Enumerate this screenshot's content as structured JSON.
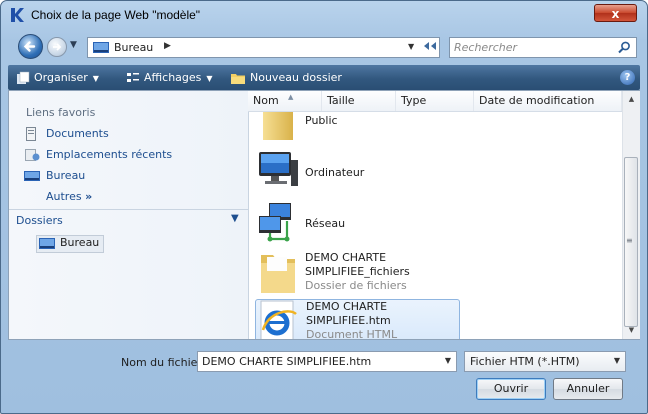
{
  "window": {
    "title": "Choix de la page Web \"modèle\"",
    "close_label": "x"
  },
  "address": {
    "location": "Bureau",
    "search_placeholder": "Rechercher"
  },
  "toolbar": {
    "organize": "Organiser",
    "views": "Affichages",
    "new_folder": "Nouveau dossier"
  },
  "sidebar": {
    "favorites_heading": "Liens favoris",
    "items": [
      {
        "label": "Documents",
        "icon": "documents-icon"
      },
      {
        "label": "Emplacements récents",
        "icon": "recent-places-icon"
      },
      {
        "label": "Bureau",
        "icon": "desktop-icon"
      }
    ],
    "more_label": "Autres",
    "more_chevron": "»",
    "folders_heading": "Dossiers",
    "tree_item": "Bureau"
  },
  "columns": [
    "Nom",
    "Taille",
    "Type",
    "Date de modification"
  ],
  "files": [
    {
      "name": "Public",
      "name2": "",
      "type": "",
      "icon": "folder-icon"
    },
    {
      "name": "Ordinateur",
      "name2": "",
      "type": "",
      "icon": "computer-icon"
    },
    {
      "name": "Réseau",
      "name2": "",
      "type": "",
      "icon": "network-icon"
    },
    {
      "name": "DEMO CHARTE",
      "name2": "SIMPLIFIEE_fichiers",
      "type": "Dossier de fichiers",
      "icon": "folder-icon"
    },
    {
      "name": "DEMO CHARTE",
      "name2": "SIMPLIFIEE.htm",
      "type": "Document HTML",
      "icon": "ie-html-icon",
      "selected": true
    }
  ],
  "footer": {
    "filename_label": "Nom du fichier :",
    "filename_value": "DEMO CHARTE SIMPLIFIEE.htm",
    "filetype_value": "Fichier HTM (*.HTM)",
    "open_button": "Ouvrir",
    "cancel_button": "Annuler"
  },
  "colors": {
    "accent": "#3d6a9e",
    "link": "#1d4e8f",
    "close": "#c9472c"
  }
}
